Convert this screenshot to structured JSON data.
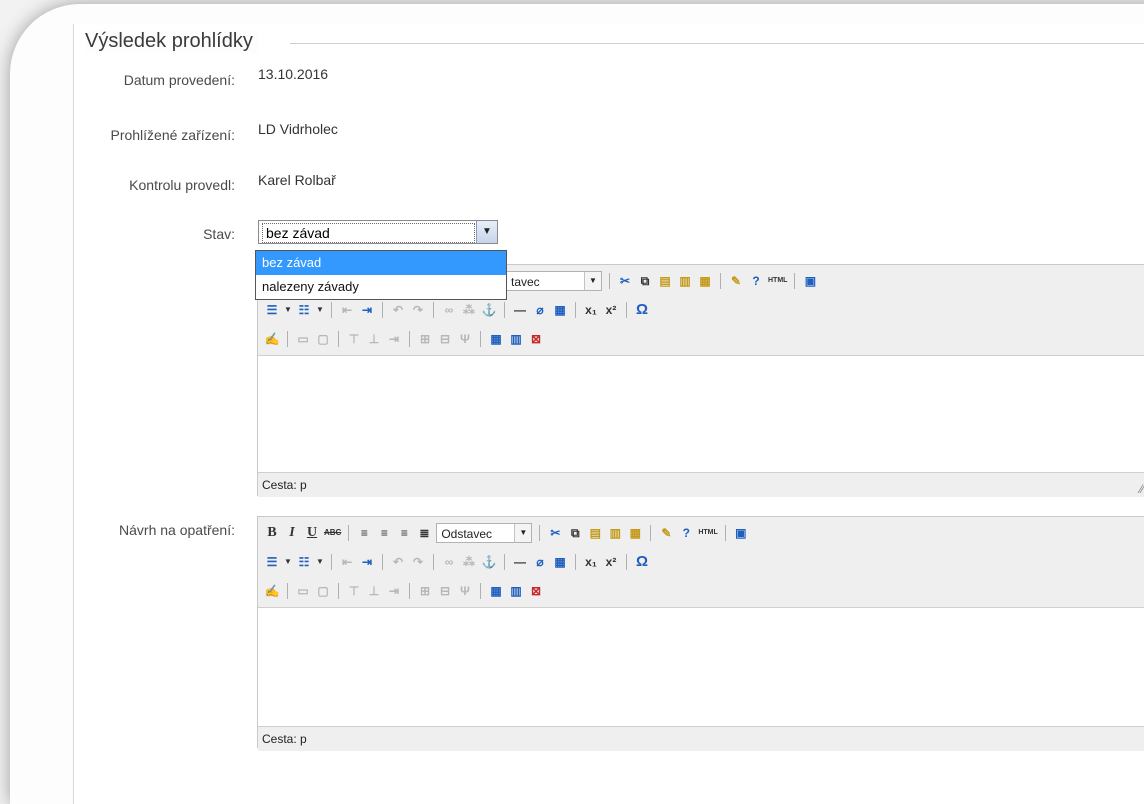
{
  "section": {
    "title": "Výsledek prohlídky"
  },
  "fields": {
    "date": {
      "label": "Datum provedení:",
      "value": "13.10.2016"
    },
    "device": {
      "label": "Prohlížené zařízení:",
      "value": "LD Vidrholec"
    },
    "inspector": {
      "label": "Kontrolu provedl:",
      "value": "Karel Rolbař"
    },
    "state": {
      "label": "Stav:",
      "selected": "bez závad",
      "options": [
        "bez závad",
        "nalezeny závady"
      ]
    },
    "proposal": {
      "label": "Návrh na opatření:"
    }
  },
  "editor": {
    "format_value": "Odstavec",
    "format_value_clipped": "tavec",
    "path_label": "Cesta: p"
  },
  "icons": {
    "bold": "B",
    "italic": "I",
    "underline": "U",
    "strike": "ABC",
    "html": "HTML",
    "subscript": "x₁",
    "superscript": "x²",
    "omega": "Ω"
  }
}
